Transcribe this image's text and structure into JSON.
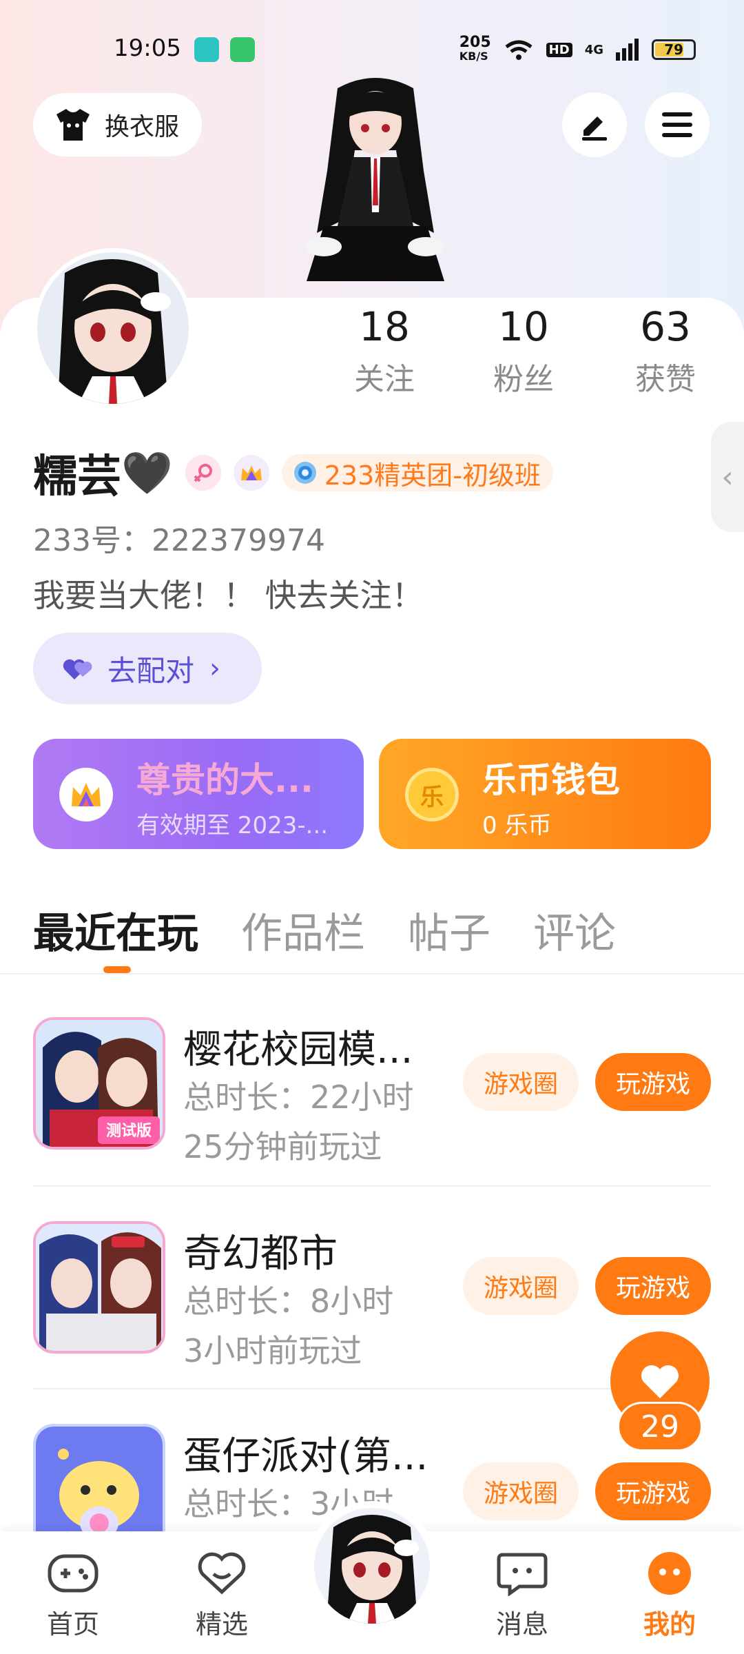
{
  "status_bar": {
    "time": "19:05",
    "net_speed_top": "205",
    "net_speed_unit": "KB/S",
    "hd_label": "HD",
    "net_type": "4G",
    "battery": "79",
    "icons": [
      "app-notification-icon",
      "app-notification-icon-2",
      "wifi-icon",
      "signal-icon",
      "battery-icon"
    ]
  },
  "header": {
    "dress_button_label": "换衣服",
    "edit_icon": "pencil-icon",
    "menu_icon": "hamburger-menu-icon"
  },
  "profile": {
    "name": "糯芸",
    "name_emoji": "🖤",
    "rank_badge": "233精英团-初级班",
    "uid_label": "233号：",
    "uid_value": "222379974",
    "bio": "我要当大佬！！ 快去关注！",
    "pair_button": "去配对"
  },
  "stats": [
    {
      "num": "18",
      "label": "关注"
    },
    {
      "num": "10",
      "label": "粉丝"
    },
    {
      "num": "63",
      "label": "获赞"
    }
  ],
  "cards": {
    "vip_title": "尊贵的大...",
    "vip_sub": "有效期至 2023-...",
    "wallet_title": "乐币钱包",
    "wallet_sub": "0 乐币",
    "wallet_coin_char": "乐"
  },
  "tabs": [
    "最近在玩",
    "作品栏",
    "帖子",
    "评论"
  ],
  "games": [
    {
      "title": "樱花校园模...",
      "duration": "总时长：22小时",
      "last_played": "25分钟前玩过",
      "circle_label": "游戏圈",
      "play_label": "玩游戏",
      "thumb_text": "测试版"
    },
    {
      "title": "奇幻都市",
      "duration": "总时长：8小时",
      "last_played": "3小时前玩过",
      "circle_label": "游戏圈",
      "play_label": "玩游戏"
    },
    {
      "title": "蛋仔派对(第...",
      "duration": "总时长：3小时",
      "last_played": "",
      "circle_label": "游戏圈",
      "play_label": "玩游戏"
    }
  ],
  "like_fab": {
    "count": "29"
  },
  "nav": [
    {
      "label": "首页",
      "icon": "gamepad-icon"
    },
    {
      "label": "精选",
      "icon": "heart-chat-icon"
    },
    {
      "label": "消息",
      "icon": "message-icon"
    },
    {
      "label": "我的",
      "icon": "my-profile-icon"
    }
  ],
  "colors": {
    "accent": "#ff7a12",
    "purple": "#9a6bf6",
    "pair_text": "#5b4fd6"
  }
}
